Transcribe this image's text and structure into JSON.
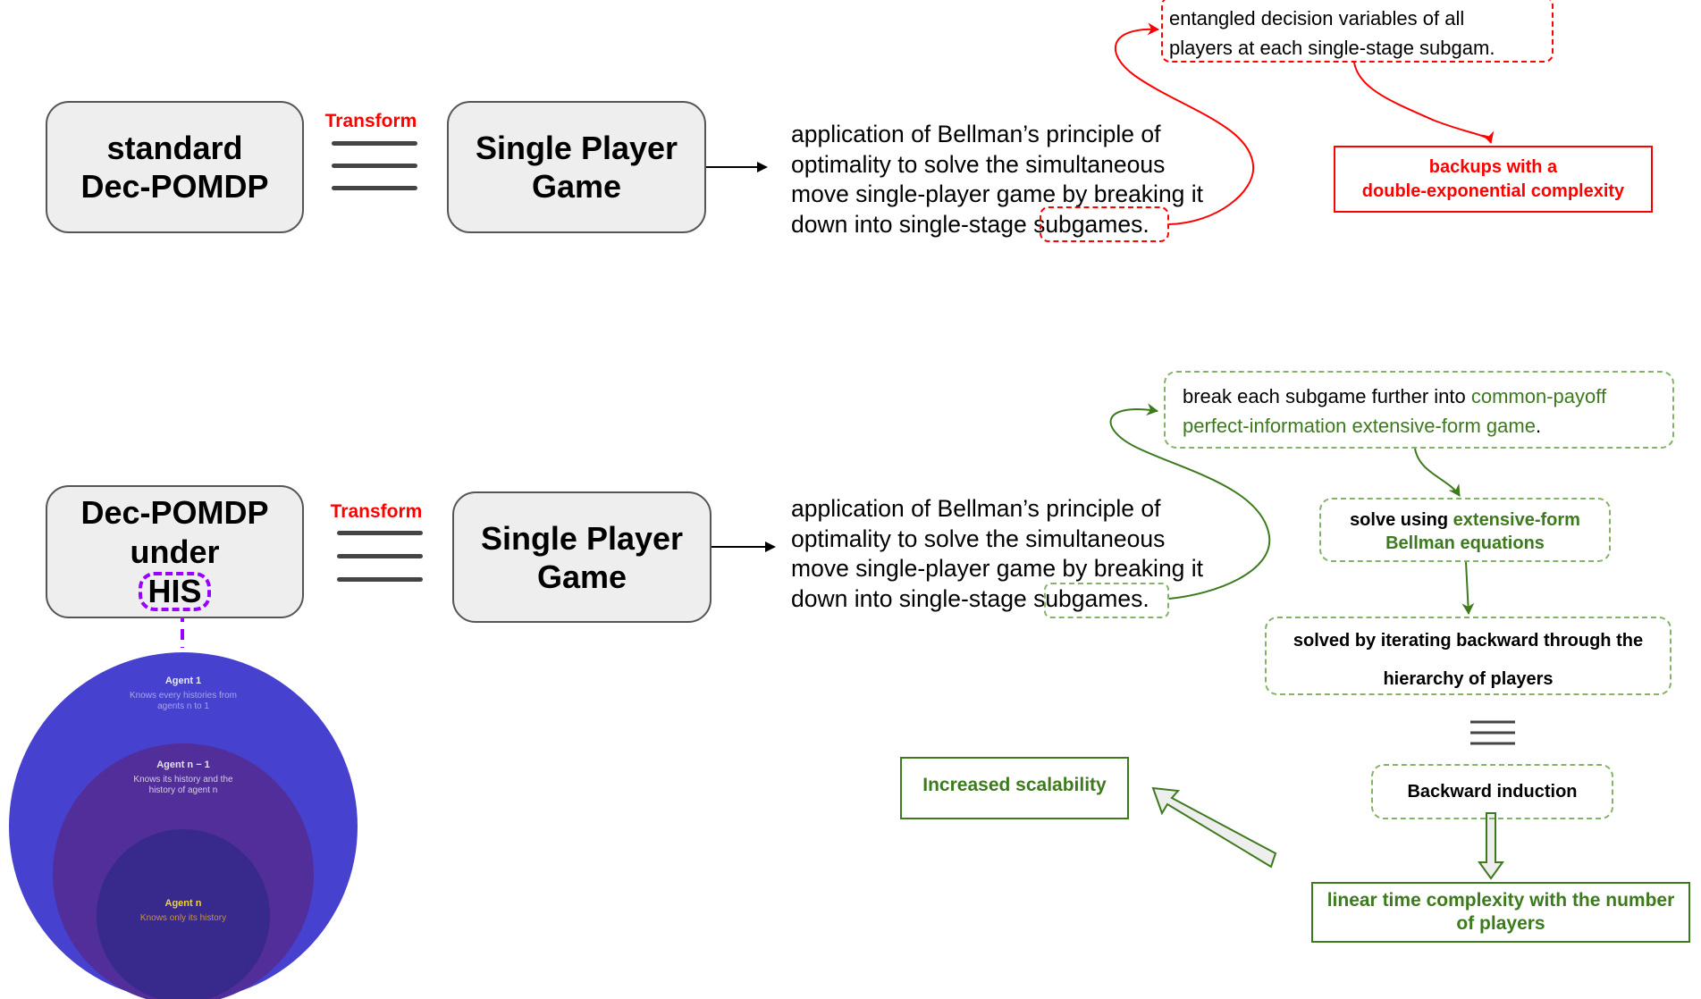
{
  "top_row": {
    "source_box": {
      "line1": "standard",
      "line2": "Dec-POMDP"
    },
    "transform_label": "Transform",
    "target_box": {
      "line1": "Single Player",
      "line2": "Game"
    },
    "explanation": {
      "lines": [
        "application of Bellman’s principle of",
        "optimality to solve the simultaneous",
        "move single-player game by breaking it",
        "down into single-stage "
      ],
      "highlight": "subgames."
    },
    "entangled_note": {
      "line1": "entangled decision variables of all",
      "line2": "players at each single-stage subgam."
    },
    "result_box": {
      "line1": "backups with a",
      "line2": "double-exponential complexity"
    },
    "accent_color": "#ff0000"
  },
  "bottom_row": {
    "source_box": {
      "line1": "Dec-POMDP",
      "line2": "under",
      "line3": "HIS"
    },
    "transform_label": "Transform",
    "target_box": {
      "line1": "Single Player",
      "line2": "Game"
    },
    "explanation": {
      "lines": [
        "application of Bellman’s principle of",
        "optimality to solve the simultaneous",
        "move single-player game by breaking it",
        "down into single-stage "
      ],
      "highlight": "subgames."
    },
    "break_note": {
      "prefix": "break each subgame further into ",
      "highlight1": "common-payoff",
      "highlight2": "perfect-information extensive-form game",
      "suffix": "."
    },
    "solve_note": {
      "prefix": "solve using ",
      "highlight1": "extensive-form",
      "highlight2": "Bellman equations"
    },
    "iterate_note": {
      "line1": "solved by iterating backward through the",
      "line2": "hierarchy of players"
    },
    "backward_induction": "Backward induction",
    "linear_box": {
      "line1": "linear time complexity with the number",
      "line2": "of players"
    },
    "scalability_box": "Increased scalability",
    "accent_color": "#3d7a1e",
    "his_color": "#9900ff"
  },
  "his_circles": [
    {
      "title": "Agent 1",
      "desc_line1": "Knows every histories from",
      "desc_line2": "agents n to 1",
      "color": "#4641cf"
    },
    {
      "title": "Agent n − 1",
      "desc_line1": "Knows its history and the",
      "desc_line2": "history of agent n",
      "color": "#522e9b"
    },
    {
      "title": "Agent n",
      "desc_line1": "Knows only its history",
      "desc_line2": "",
      "color": "#372a8c"
    }
  ]
}
